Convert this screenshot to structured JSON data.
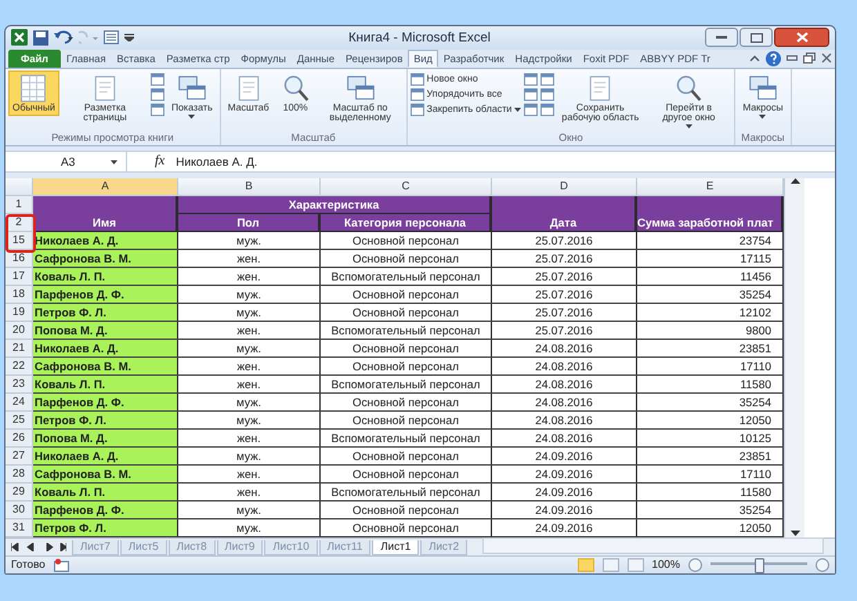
{
  "window": {
    "title": "Книга4 - Microsoft Excel"
  },
  "ribbon_tabs": [
    {
      "label": "Файл",
      "kind": "file",
      "selected": false
    },
    {
      "label": "Главная",
      "kind": "tab",
      "selected": false
    },
    {
      "label": "Вставка",
      "kind": "tab",
      "selected": false
    },
    {
      "label": "Разметка стр",
      "kind": "tab",
      "selected": false
    },
    {
      "label": "Формулы",
      "kind": "tab",
      "selected": false
    },
    {
      "label": "Данные",
      "kind": "tab",
      "selected": false
    },
    {
      "label": "Рецензиров",
      "kind": "tab",
      "selected": false
    },
    {
      "label": "Вид",
      "kind": "tab",
      "selected": true
    },
    {
      "label": "Разработчик",
      "kind": "tab",
      "selected": false
    },
    {
      "label": "Надстройки",
      "kind": "tab",
      "selected": false
    },
    {
      "label": "Foxit PDF",
      "kind": "tab",
      "selected": false
    },
    {
      "label": "ABBYY PDF Tr",
      "kind": "tab",
      "selected": false
    }
  ],
  "ribbon_groups": [
    {
      "label": "Режимы просмотра книги",
      "buttons": [
        {
          "kind": "large",
          "label": "Обычный",
          "selected": true
        },
        {
          "kind": "large",
          "label": "Разметка страницы",
          "selected": false
        },
        {
          "kind": "stack"
        },
        {
          "kind": "large",
          "label": "Показать",
          "dropdown": true,
          "selected": false
        }
      ]
    },
    {
      "label": "Масштаб",
      "buttons": [
        {
          "kind": "large",
          "label": "Масштаб",
          "selected": false
        },
        {
          "kind": "large",
          "label": "100%",
          "selected": false
        },
        {
          "kind": "large",
          "label": "Масштаб по выделенному",
          "selected": false
        }
      ]
    },
    {
      "label": "Окно",
      "buttons": [
        {
          "kind": "rows",
          "items": [
            {
              "label": "Новое окно"
            },
            {
              "label": "Упорядочить все"
            },
            {
              "label": "Закрепить области",
              "dropdown": true
            }
          ]
        },
        {
          "kind": "stack"
        },
        {
          "kind": "stack"
        },
        {
          "kind": "large",
          "label": "Сохранить рабочую область",
          "selected": false
        },
        {
          "kind": "large",
          "label": "Перейти в другое окно",
          "dropdown": true,
          "selected": false
        }
      ]
    },
    {
      "label": "Макросы",
      "buttons": [
        {
          "kind": "large",
          "label": "Макросы",
          "dropdown": true,
          "selected": false
        }
      ]
    }
  ],
  "formula_bar": {
    "name_box": "A3",
    "function_label": "fx",
    "formula": "Николаев А. Д."
  },
  "sheet": {
    "columns": [
      {
        "label": "A",
        "selected": true
      },
      {
        "label": "B",
        "selected": false
      },
      {
        "label": "C",
        "selected": false
      },
      {
        "label": "D",
        "selected": false
      },
      {
        "label": "E",
        "selected": false
      }
    ],
    "split_marked": true,
    "header_row_numbers": [
      "1",
      "2"
    ],
    "header": {
      "name": "Имя",
      "group": "Характеристика",
      "subheaders": [
        "Пол",
        "Категория персонала"
      ],
      "date": "Дата",
      "amount": "Сумма заработной плат"
    },
    "rows": [
      {
        "number": "15",
        "cells": [
          "Николаев А. Д.",
          "муж.",
          "Основной персонал",
          "25.07.2016",
          "23754"
        ]
      },
      {
        "number": "16",
        "cells": [
          "Сафронова В. М.",
          "жен.",
          "Основной персонал",
          "25.07.2016",
          "17115"
        ]
      },
      {
        "number": "17",
        "cells": [
          "Коваль Л. П.",
          "жен.",
          "Вспомогательный персонал",
          "25.07.2016",
          "11456"
        ]
      },
      {
        "number": "18",
        "cells": [
          "Парфенов Д. Ф.",
          "муж.",
          "Основной персонал",
          "25.07.2016",
          "35254"
        ]
      },
      {
        "number": "19",
        "cells": [
          "Петров Ф. Л.",
          "муж.",
          "Основной персонал",
          "25.07.2016",
          "12102"
        ]
      },
      {
        "number": "20",
        "cells": [
          "Попова М. Д.",
          "жен.",
          "Вспомогательный персонал",
          "25.07.2016",
          "9800"
        ]
      },
      {
        "number": "21",
        "cells": [
          "Николаев А. Д.",
          "муж.",
          "Основной персонал",
          "24.08.2016",
          "23851"
        ]
      },
      {
        "number": "22",
        "cells": [
          "Сафронова В. М.",
          "жен.",
          "Основной персонал",
          "24.08.2016",
          "17110"
        ]
      },
      {
        "number": "23",
        "cells": [
          "Коваль Л. П.",
          "жен.",
          "Вспомогательный персонал",
          "24.08.2016",
          "11580"
        ]
      },
      {
        "number": "24",
        "cells": [
          "Парфенов Д. Ф.",
          "муж.",
          "Основной персонал",
          "24.08.2016",
          "35254"
        ]
      },
      {
        "number": "25",
        "cells": [
          "Петров Ф. Л.",
          "муж.",
          "Основной персонал",
          "24.08.2016",
          "12050"
        ]
      },
      {
        "number": "26",
        "cells": [
          "Попова М. Д.",
          "жен.",
          "Вспомогательный персонал",
          "24.08.2016",
          "10125"
        ]
      },
      {
        "number": "27",
        "cells": [
          "Николаев А. Д.",
          "муж.",
          "Основной персонал",
          "24.09.2016",
          "23851"
        ]
      },
      {
        "number": "28",
        "cells": [
          "Сафронова В. М.",
          "жен.",
          "Основной персонал",
          "24.09.2016",
          "17110"
        ]
      },
      {
        "number": "29",
        "cells": [
          "Коваль Л. П.",
          "жен.",
          "Вспомогательный персонал",
          "24.09.2016",
          "11580"
        ]
      },
      {
        "number": "30",
        "cells": [
          "Парфенов Д. Ф.",
          "муж.",
          "Основной персонал",
          "24.09.2016",
          "35254"
        ]
      },
      {
        "number": "31",
        "cells": [
          "Петров Ф. Л.",
          "муж.",
          "Основной персонал",
          "24.09.2016",
          "12050"
        ]
      }
    ]
  },
  "sheet_tabs": [
    {
      "label": "Лист7",
      "selected": false
    },
    {
      "label": "Лист5",
      "selected": false
    },
    {
      "label": "Лист8",
      "selected": false
    },
    {
      "label": "Лист9",
      "selected": false
    },
    {
      "label": "Лист10",
      "selected": false
    },
    {
      "label": "Лист11",
      "selected": false
    },
    {
      "label": "Лист1",
      "selected": true
    },
    {
      "label": "Лист2",
      "selected": false
    }
  ],
  "status_bar": {
    "status": "Готово",
    "zoom": "100%",
    "level": 0.5
  }
}
